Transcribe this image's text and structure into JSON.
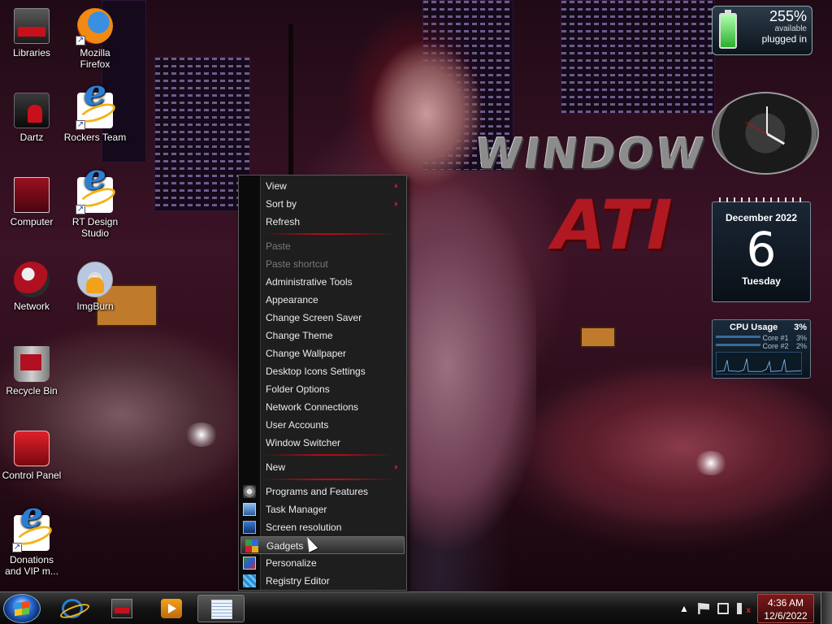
{
  "desktop_icons": [
    {
      "name": "libraries",
      "label": "Libraries",
      "icon": "libraries-icon"
    },
    {
      "name": "firefox",
      "label": "Mozilla Firefox",
      "icon": "firefox-icon"
    },
    {
      "name": "dartz",
      "label": "Dartz",
      "icon": "dartz-icon"
    },
    {
      "name": "rockers-team",
      "label": "Rockers Team",
      "icon": "internet-explorer-icon"
    },
    {
      "name": "computer",
      "label": "Computer",
      "icon": "computer-icon"
    },
    {
      "name": "rt-design-studio",
      "label": "RT Design Studio",
      "icon": "internet-explorer-icon"
    },
    {
      "name": "network",
      "label": "Network",
      "icon": "network-icon"
    },
    {
      "name": "imgburn",
      "label": "ImgBurn",
      "icon": "imgburn-icon"
    },
    {
      "name": "recycle-bin",
      "label": "Recycle Bin",
      "icon": "recycle-bin-icon"
    },
    {
      "name": "control-panel",
      "label": "Control Panel",
      "icon": "control-panel-icon"
    },
    {
      "name": "donations",
      "label": "Donations and VIP m...",
      "icon": "internet-explorer-icon"
    }
  ],
  "wallpaper": {
    "logo_line1": "WINDOW",
    "logo_line2": "ATI"
  },
  "context_menu": {
    "items": [
      {
        "label": "View",
        "submenu": true
      },
      {
        "label": "Sort by",
        "submenu": true
      },
      {
        "label": "Refresh"
      },
      {
        "label": "Paste",
        "disabled": true
      },
      {
        "label": "Paste shortcut",
        "disabled": true
      },
      {
        "label": "Administrative Tools"
      },
      {
        "label": "Appearance"
      },
      {
        "label": "Change Screen Saver"
      },
      {
        "label": "Change Theme"
      },
      {
        "label": "Change Wallpaper"
      },
      {
        "label": "Desktop Icons Settings"
      },
      {
        "label": "Folder Options"
      },
      {
        "label": "Network Connections"
      },
      {
        "label": "User Accounts"
      },
      {
        "label": "Window Switcher"
      },
      {
        "label": "New",
        "submenu": true
      },
      {
        "label": "Programs and Features",
        "icon": "programs-features-icon"
      },
      {
        "label": "Task Manager",
        "icon": "task-manager-icon"
      },
      {
        "label": "Screen resolution",
        "icon": "screen-resolution-icon"
      },
      {
        "label": "Gadgets",
        "icon": "gadgets-icon",
        "highlighted": true
      },
      {
        "label": "Personalize",
        "icon": "personalize-icon"
      },
      {
        "label": "Registry Editor",
        "icon": "registry-editor-icon"
      }
    ]
  },
  "battery_gadget": {
    "percent": "255%",
    "line1": "available",
    "line2": "plugged in"
  },
  "calendar_gadget": {
    "month": "December 2022",
    "day": "6",
    "weekday": "Tuesday"
  },
  "cpu_gadget": {
    "title": "CPU Usage",
    "total": "3%",
    "core1_label": "Core #1",
    "core1_value": "3%",
    "core2_label": "Core #2",
    "core2_value": "2%"
  },
  "taskbar": {
    "pinned": [
      "internet-explorer-icon",
      "libraries-icon",
      "media-player-icon",
      "notepad-icon"
    ],
    "time": "4:36 AM",
    "date": "12/6/2022"
  },
  "colors": {
    "accent": "#b00a18",
    "menu_bg": "#1e1e1e"
  }
}
